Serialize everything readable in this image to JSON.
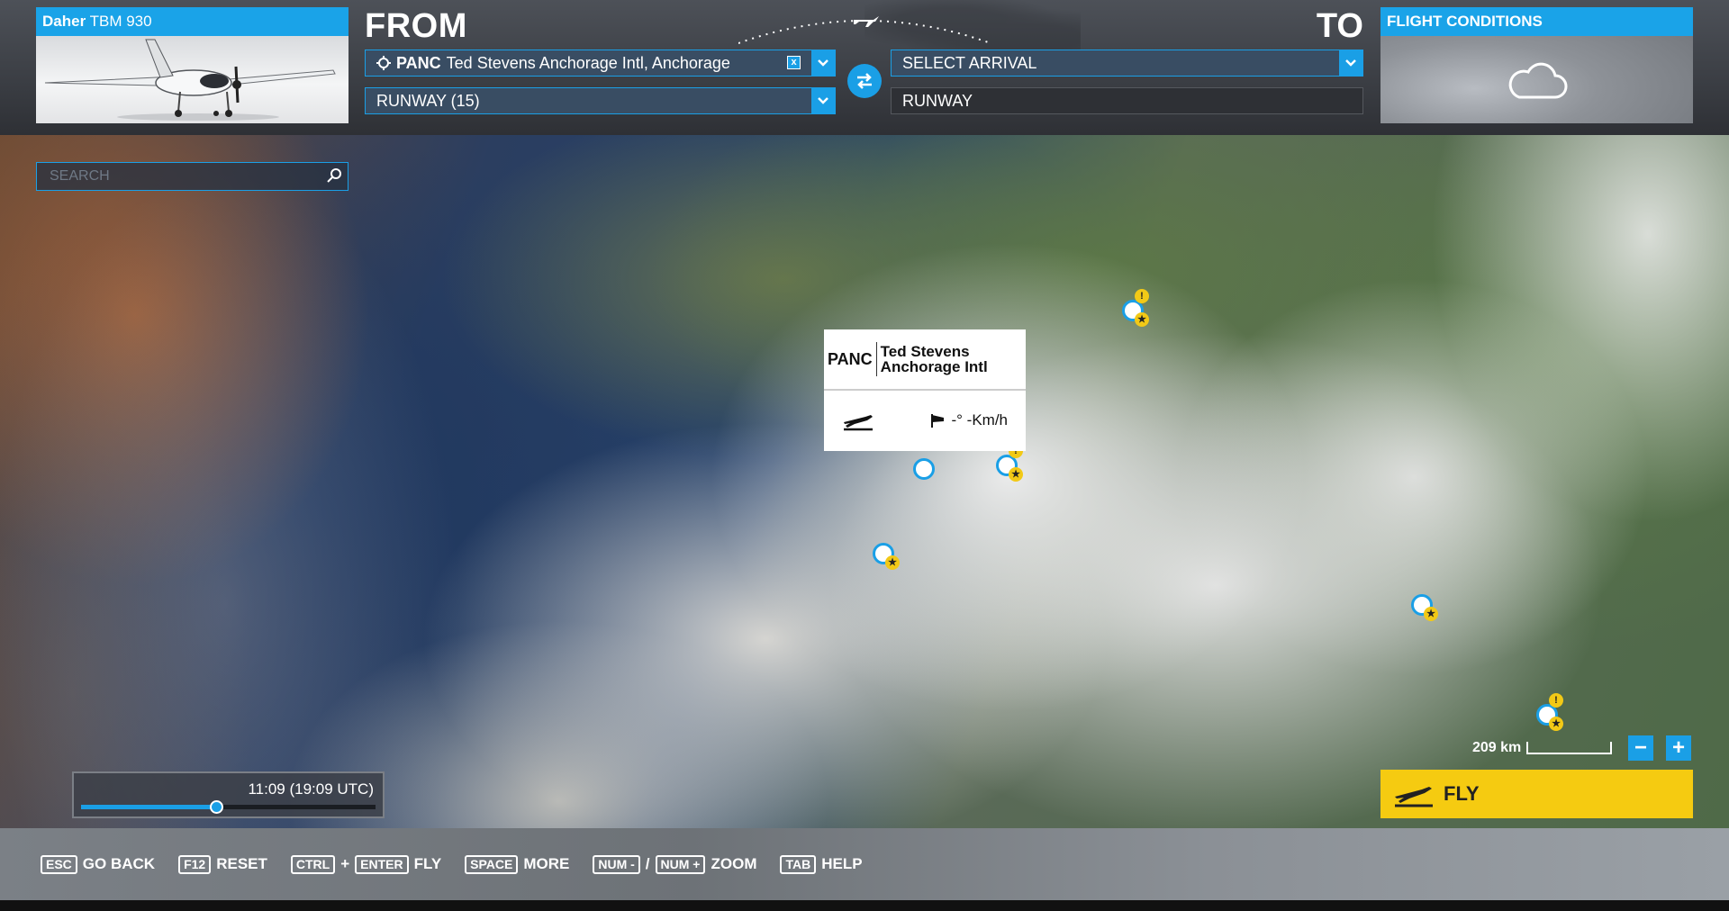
{
  "aircraft": {
    "brand": "Daher",
    "model": "TBM 930"
  },
  "from": {
    "label": "FROM",
    "airport_code": "PANC",
    "airport_name": "Ted Stevens Anchorage Intl, Anchorage",
    "clear_icon": "x",
    "runway": "RUNWAY (15)"
  },
  "to": {
    "label": "TO",
    "placeholder": "SELECT ARRIVAL",
    "runway": "RUNWAY"
  },
  "conditions": {
    "title": "FLIGHT CONDITIONS",
    "icon": "cloud-icon"
  },
  "search": {
    "placeholder": "SEARCH"
  },
  "tooltip": {
    "code": "PANC",
    "name": "Ted Stevens Anchorage Intl",
    "wind": "-° -Km/h"
  },
  "time": {
    "display": "11:09 (19:09 UTC)",
    "progress": 0.46
  },
  "scale": {
    "label": "209 km",
    "minus": "−",
    "plus": "+"
  },
  "fly": {
    "label": "FLY"
  },
  "hints": [
    {
      "keys": [
        "ESC"
      ],
      "label": "GO BACK"
    },
    {
      "keys": [
        "F12"
      ],
      "label": "RESET"
    },
    {
      "keys": [
        "CTRL",
        "ENTER"
      ],
      "sep": "+",
      "label": "FLY"
    },
    {
      "keys": [
        "SPACE"
      ],
      "label": "MORE"
    },
    {
      "keys": [
        "NUM -",
        "NUM +"
      ],
      "sep": "/",
      "label": "ZOOM"
    },
    {
      "keys": [
        "TAB"
      ],
      "label": "HELP"
    }
  ],
  "colors": {
    "accent": "#1a9fe6",
    "fly": "#f5cb11",
    "star": "#f2c916"
  }
}
